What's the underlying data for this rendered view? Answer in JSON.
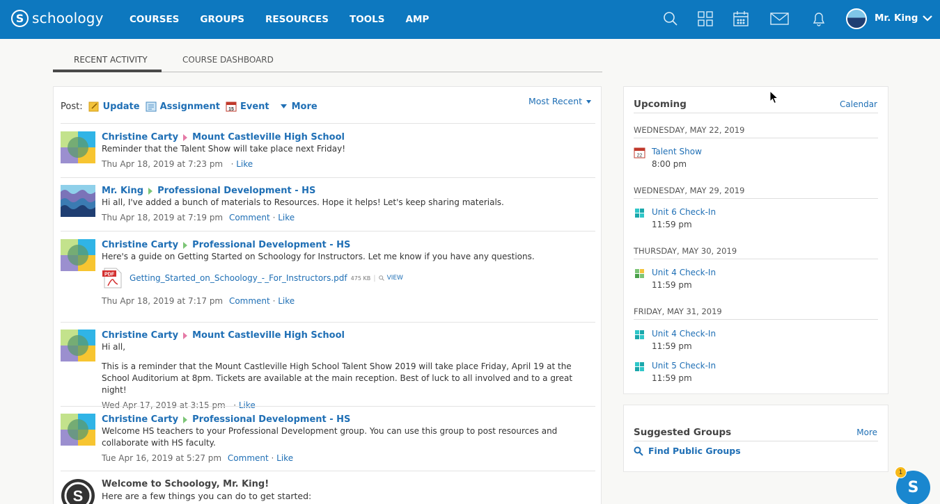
{
  "brand": {
    "name": "schoology",
    "mark": "S"
  },
  "nav": {
    "items": [
      "COURSES",
      "GROUPS",
      "RESOURCES",
      "TOOLS",
      "AMP"
    ]
  },
  "nav_icons": [
    "search-icon",
    "apps-grid-icon",
    "calendar-icon",
    "mail-icon",
    "notifications-icon"
  ],
  "user": {
    "name": "Mr. King"
  },
  "tabs": {
    "recent": "RECENT ACTIVITY",
    "dashboard": "COURSE DASHBOARD"
  },
  "post": {
    "label": "Post:",
    "update": "Update",
    "assignment": "Assignment",
    "event": "Event",
    "more": "More",
    "sort": "Most Recent"
  },
  "feed": [
    {
      "author": "Christine Carty",
      "target": "Mount Castleville High School",
      "message": "Reminder that the Talent Show will take place next Friday!",
      "time": "Thu Apr 18, 2019 at 7:23 pm",
      "comment": "",
      "like": "Like"
    },
    {
      "author": "Mr. King",
      "target": "Professional Development - HS",
      "message": "Hi all, I've added a bunch of materials to Resources. Hope it helps! Let's keep sharing materials.",
      "time": "Thu Apr 18, 2019 at 7:19 pm",
      "comment": "Comment",
      "like": "Like"
    },
    {
      "author": "Christine Carty",
      "target": "Professional Development - HS",
      "message": "Here's a guide on Getting Started on Schoology for Instructors. Let me know if you have any questions.",
      "attachment": {
        "name": "Getting_Started_on_Schoology_-_For_Instructors.pdf",
        "size": "475 KB",
        "view": "VIEW",
        "type_label": "PDF"
      },
      "time": "Thu Apr 18, 2019 at 7:17 pm",
      "comment": "Comment",
      "like": "Like"
    },
    {
      "author": "Christine Carty",
      "target": "Mount Castleville High School",
      "message": "Hi all,",
      "message2": "This is a reminder that the Mount Castleville High School Talent Show 2019 will take place Friday, April 19 at the School Auditorium at 8pm. Tickets are available at the main reception. Best of luck to all involved and to a great night!",
      "time": "Wed Apr 17, 2019 at 3:15 pm",
      "comment": "",
      "like": "Like"
    },
    {
      "author": "Christine Carty",
      "target": "Professional Development - HS",
      "message": "Welcome HS teachers to your Professional Development group. You can use this group to post resources and collaborate with HS faculty.",
      "time": "Tue Apr 16, 2019 at 5:27 pm",
      "comment": "Comment",
      "like": "Like"
    },
    {
      "author": "Welcome to Schoology, Mr. King!",
      "message": "Here are a few things you can do to get started:"
    }
  ],
  "upcoming": {
    "title": "Upcoming",
    "calendar_link": "Calendar",
    "days": [
      {
        "date": "WEDNESDAY, MAY 22, 2019",
        "events": [
          {
            "name": "Talent Show",
            "time": "8:00 pm",
            "icon": "event-calendar-icon",
            "day_num": "22"
          }
        ]
      },
      {
        "date": "WEDNESDAY, MAY 29, 2019",
        "events": [
          {
            "name": "Unit 6 Check-In",
            "time": "11:59 pm",
            "icon": "assessment-puzzle-icon"
          }
        ]
      },
      {
        "date": "THURSDAY, MAY 30, 2019",
        "events": [
          {
            "name": "Unit 4 Check-In",
            "time": "11:59 pm",
            "icon": "assessment-puzzle-icon"
          }
        ]
      },
      {
        "date": "FRIDAY, MAY 31, 2019",
        "events": [
          {
            "name": "Unit 4 Check-In",
            "time": "11:59 pm",
            "icon": "assessment-puzzle-icon"
          },
          {
            "name": "Unit 5 Check-In",
            "time": "11:59 pm",
            "icon": "assessment-puzzle-icon"
          }
        ]
      }
    ]
  },
  "suggested": {
    "title": "Suggested Groups",
    "more": "More",
    "find": "Find Public Groups"
  },
  "chat": {
    "letter": "S",
    "badge": "1"
  },
  "colors": {
    "nav_bg": "#0d78bf",
    "link": "#1f6fb5",
    "accent_teal": "#2fc7c9",
    "badge": "#f6b91a"
  }
}
